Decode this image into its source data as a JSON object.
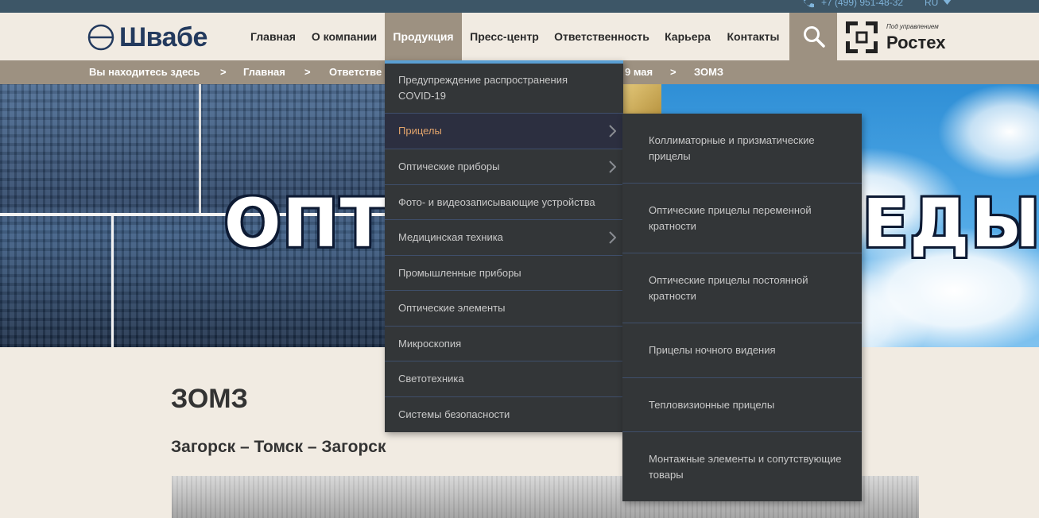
{
  "topbar": {
    "phone": "+7 (499) 951-48-32",
    "language": "RU",
    "phone_icon": "phone-icon",
    "lang_caret_icon": "caret-down-icon"
  },
  "header": {
    "logo_text": "Швабе",
    "nav": [
      {
        "label": "Главная",
        "active": false
      },
      {
        "label": "О компании",
        "active": false
      },
      {
        "label": "Продукция",
        "active": true
      },
      {
        "label": "Пресс-центр",
        "active": false
      },
      {
        "label": "Ответственность",
        "active": false
      },
      {
        "label": "Карьера",
        "active": false
      },
      {
        "label": "Контакты",
        "active": false
      }
    ],
    "search_icon": "search-icon",
    "partner": {
      "small_text": "Под управлением",
      "name": "Ростех"
    }
  },
  "breadcrumb": {
    "prefix": "Вы находитесь здесь",
    "separator": ">",
    "items": [
      "Главная",
      "Ответстве",
      "9 мая",
      "ЗОМЗ"
    ]
  },
  "hero": {
    "title_left": "ОПТИ",
    "title_right": "ЕДЫ"
  },
  "content": {
    "title": "ЗОМЗ",
    "subtitle": "Загорск – Томск – Загорск"
  },
  "menu": {
    "items": [
      {
        "label": "Предупреждение распространения COVID-19",
        "has_submenu": false,
        "active": false
      },
      {
        "label": "Прицелы",
        "has_submenu": true,
        "active": true
      },
      {
        "label": "Оптические приборы",
        "has_submenu": true,
        "active": false
      },
      {
        "label": "Фото- и видеозаписывающие устройства",
        "has_submenu": false,
        "active": false
      },
      {
        "label": "Медицинская техника",
        "has_submenu": true,
        "active": false
      },
      {
        "label": "Промышленные приборы",
        "has_submenu": false,
        "active": false
      },
      {
        "label": "Оптические элементы",
        "has_submenu": false,
        "active": false
      },
      {
        "label": "Микроскопия",
        "has_submenu": false,
        "active": false
      },
      {
        "label": "Светотехника",
        "has_submenu": false,
        "active": false
      },
      {
        "label": "Системы безопасности",
        "has_submenu": false,
        "active": false
      }
    ],
    "submenu": [
      {
        "label": "Коллиматорные и призматические прицелы"
      },
      {
        "label": "Оптические прицелы переменной кратности"
      },
      {
        "label": "Оптические прицелы постоянной кратности"
      },
      {
        "label": "Прицелы ночного видения"
      },
      {
        "label": "Тепловизионные прицелы"
      },
      {
        "label": "Монтажные элементы и сопутствующие товары"
      }
    ]
  },
  "colors": {
    "topbar": "#3d5667",
    "header_bg": "#f1ebe2",
    "nav_active": "#9d9181",
    "menu_bg": "#333638",
    "menu_active_text": "#e2a46b",
    "menu_accent": "#5a9fd3"
  }
}
